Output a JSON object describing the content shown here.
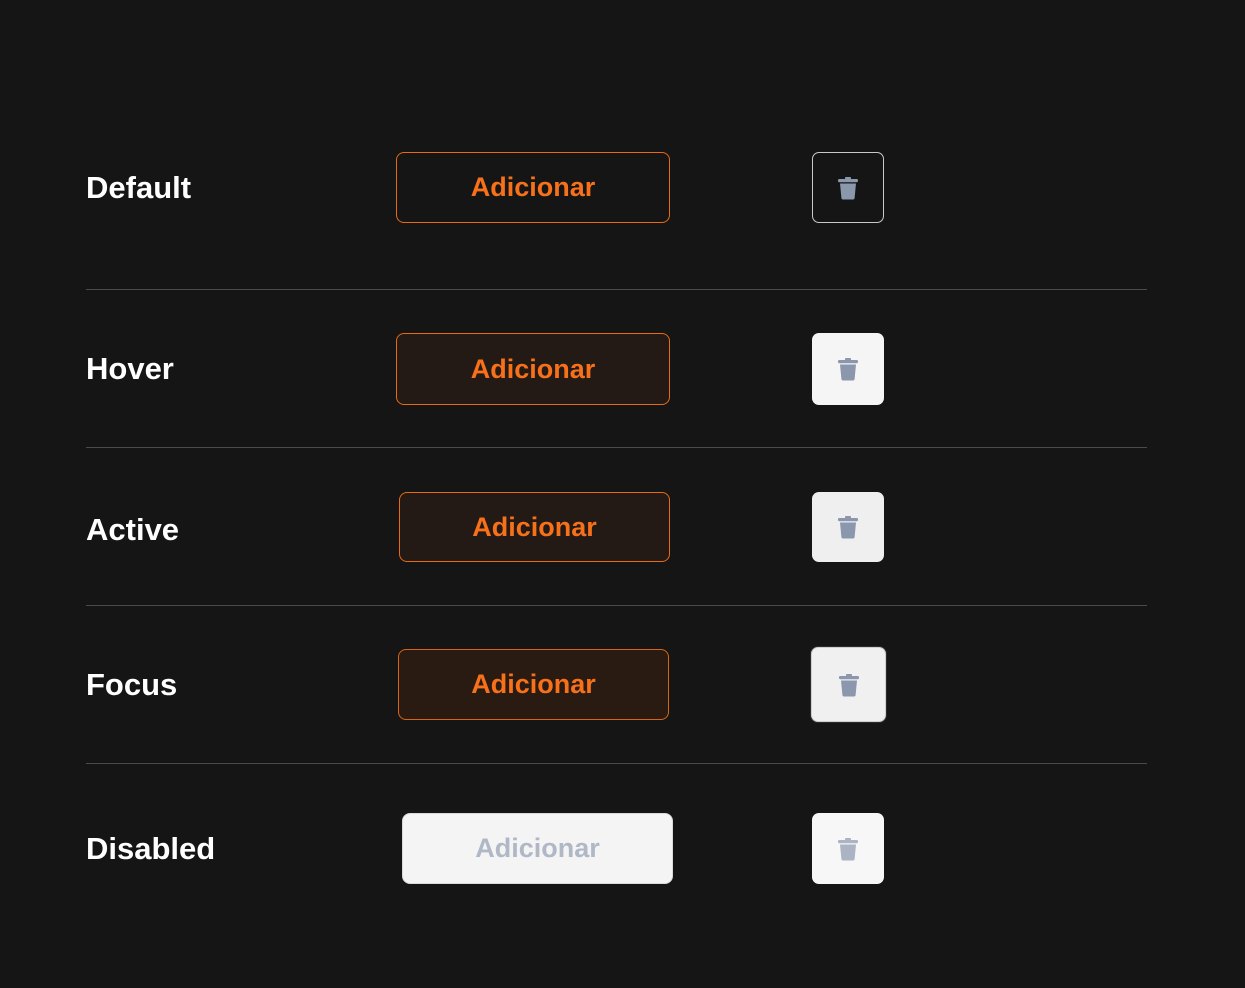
{
  "colors": {
    "background": "#151515",
    "label_text": "#ffffff",
    "accent_orange": "#f7701a",
    "accent_border": "#ea6a10",
    "divider": "#4a4a4a",
    "trash_icon": "#8a97ad",
    "disabled_text": "#b0b8c6",
    "disabled_trash_icon": "#aab4c4"
  },
  "rows": [
    {
      "label": "Default",
      "button_label": "Adicionar",
      "icon": "trash-icon"
    },
    {
      "label": "Hover",
      "button_label": "Adicionar",
      "icon": "trash-icon"
    },
    {
      "label": "Active",
      "button_label": "Adicionar",
      "icon": "trash-icon"
    },
    {
      "label": "Focus",
      "button_label": "Adicionar",
      "icon": "trash-icon"
    },
    {
      "label": "Disabled",
      "button_label": "Adicionar",
      "icon": "trash-icon"
    }
  ]
}
